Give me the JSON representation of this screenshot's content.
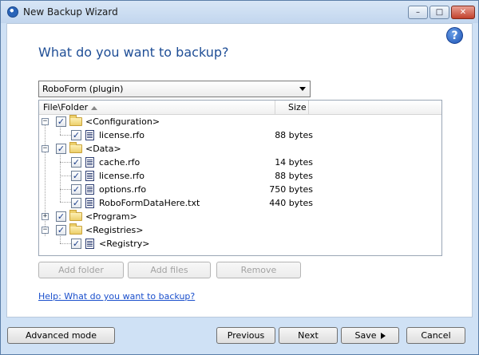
{
  "window": {
    "title": "New Backup Wizard",
    "min_label": "–",
    "max_label": "□",
    "close_label": "✕"
  },
  "help_icon": "?",
  "heading": "What do you want to backup?",
  "source_select": {
    "value": "RoboForm (plugin)"
  },
  "tree": {
    "columns": {
      "name": "File\\Folder",
      "size": "Size"
    },
    "check_mark": "✓",
    "expanded": "−",
    "collapsed": "+",
    "rows": [
      {
        "label": "<Configuration>",
        "size": ""
      },
      {
        "label": "license.rfo",
        "size": "88 bytes"
      },
      {
        "label": "<Data>",
        "size": ""
      },
      {
        "label": "cache.rfo",
        "size": "14 bytes"
      },
      {
        "label": "license.rfo",
        "size": "88 bytes"
      },
      {
        "label": "options.rfo",
        "size": "750 bytes"
      },
      {
        "label": "RoboFormDataHere.txt",
        "size": "440 bytes"
      },
      {
        "label": "<Program>",
        "size": ""
      },
      {
        "label": "<Registries>",
        "size": ""
      },
      {
        "label": "<Registry>",
        "size": ""
      }
    ]
  },
  "actions": {
    "add_folder": "Add folder",
    "add_files": "Add files",
    "remove": "Remove"
  },
  "help_link": "Help: What do you want to backup?",
  "footer": {
    "advanced": "Advanced mode",
    "previous": "Previous",
    "next": "Next",
    "save": "Save",
    "cancel": "Cancel"
  }
}
